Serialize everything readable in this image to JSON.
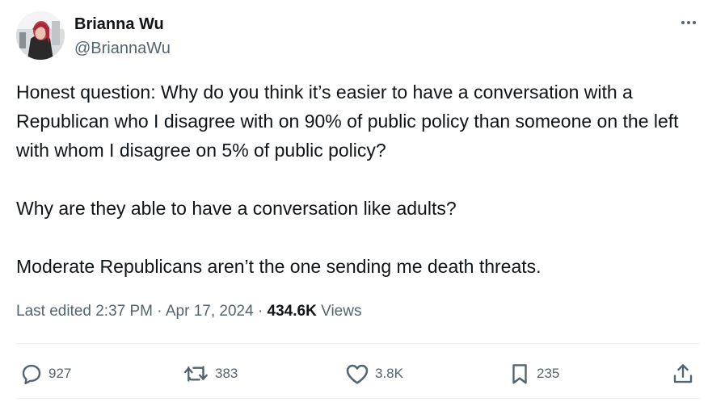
{
  "author": {
    "name": "Brianna Wu",
    "handle": "@BriannaWu",
    "avatar_icon": "profile-photo"
  },
  "tweet": {
    "paragraphs": [
      "Honest question: Why do you think it’s easier to have a conversation with a Republican who I disagree with on 90% of public policy than someone on the left with whom I disagree on 5% of public policy?",
      "Why are they able to have a conversation like adults?",
      "Moderate Republicans aren’t the one sending me death threats."
    ]
  },
  "meta": {
    "edited_label": "Last edited 2:37 PM",
    "date": "Apr 17, 2024",
    "separator": "·",
    "views_count": "434.6K",
    "views_label": "Views"
  },
  "actions": {
    "replies": "927",
    "reposts": "383",
    "likes": "3.8K",
    "bookmarks": "235"
  },
  "colors": {
    "text": "#0f1419",
    "secondary": "#536471",
    "divider": "#eff3f4"
  }
}
